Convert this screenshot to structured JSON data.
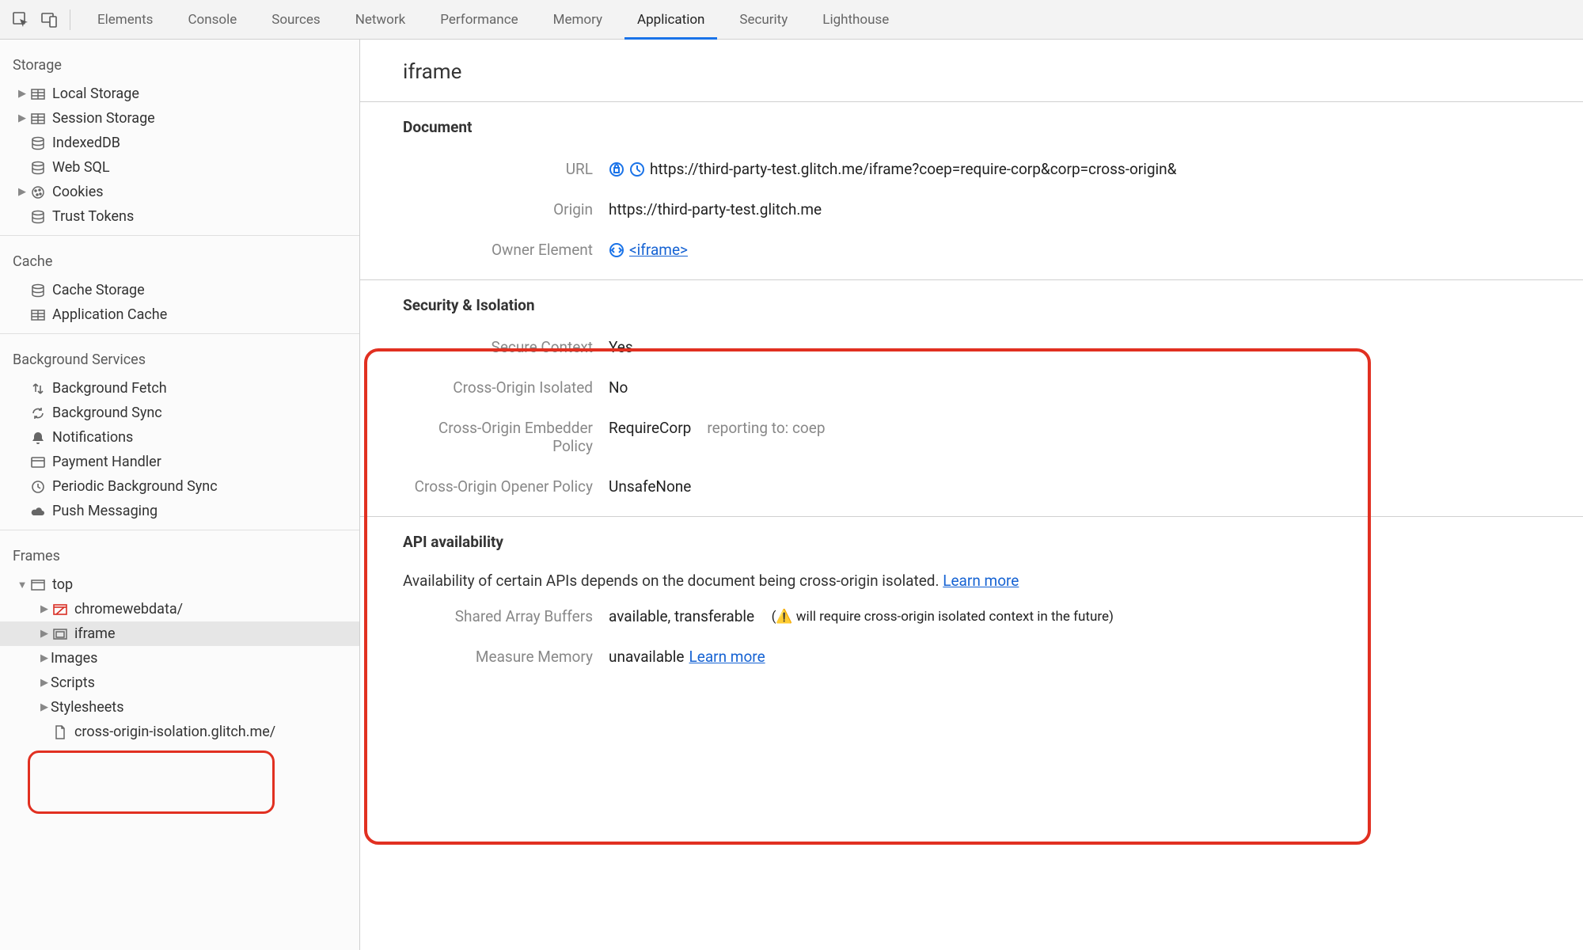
{
  "tabs": [
    "Elements",
    "Console",
    "Sources",
    "Network",
    "Performance",
    "Memory",
    "Application",
    "Security",
    "Lighthouse"
  ],
  "active_tab": "Application",
  "sidebar": {
    "storage": {
      "title": "Storage",
      "items": [
        "Local Storage",
        "Session Storage",
        "IndexedDB",
        "Web SQL",
        "Cookies",
        "Trust Tokens"
      ]
    },
    "cache": {
      "title": "Cache",
      "items": [
        "Cache Storage",
        "Application Cache"
      ]
    },
    "bg": {
      "title": "Background Services",
      "items": [
        "Background Fetch",
        "Background Sync",
        "Notifications",
        "Payment Handler",
        "Periodic Background Sync",
        "Push Messaging"
      ]
    },
    "frames": {
      "title": "Frames",
      "top": "top",
      "children": [
        "chromewebdata/",
        "iframe",
        "Images",
        "Scripts",
        "Stylesheets",
        "cross-origin-isolation.glitch.me/"
      ]
    }
  },
  "page": {
    "title": "iframe",
    "document": {
      "heading": "Document",
      "url_label": "URL",
      "url": "https://third-party-test.glitch.me/iframe?coep=require-corp&corp=cross-origin&",
      "origin_label": "Origin",
      "origin": "https://third-party-test.glitch.me",
      "owner_label": "Owner Element",
      "owner_link": "<iframe>"
    },
    "security": {
      "heading": "Security & Isolation",
      "rows": {
        "secure_context": {
          "k": "Secure Context",
          "v": "Yes"
        },
        "coi": {
          "k": "Cross-Origin Isolated",
          "v": "No"
        },
        "coep": {
          "k": "Cross-Origin Embedder Policy",
          "v": "RequireCorp",
          "extra": "reporting to: coep"
        },
        "coop": {
          "k": "Cross-Origin Opener Policy",
          "v": "UnsafeNone"
        }
      }
    },
    "api": {
      "heading": "API availability",
      "intro": "Availability of certain APIs depends on the document being cross-origin isolated. ",
      "learn_more": "Learn more",
      "sab": {
        "k": "Shared Array Buffers",
        "v": "available, transferable",
        "warn": "(⚠️  will require cross-origin isolated context in the future)"
      },
      "mm": {
        "k": "Measure Memory",
        "v": "unavailable ",
        "learn": "Learn more"
      }
    }
  }
}
